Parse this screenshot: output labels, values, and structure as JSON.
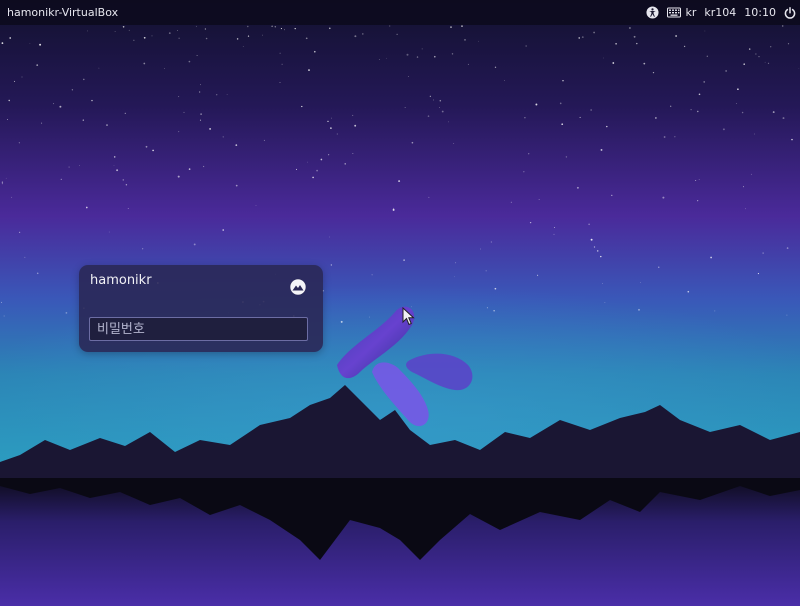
{
  "topbar": {
    "hostname": "hamonikr-VirtualBox",
    "indicators": {
      "accessibility_icon": "accessibility-icon",
      "keyboard_icon": "keyboard-icon",
      "keyboard_layout": "kr",
      "network_label": "kr104",
      "clock": "10:10",
      "power_icon": "power-icon"
    }
  },
  "login": {
    "username": "hamonikr",
    "session_icon": "session-selector-icon",
    "password_placeholder": "비밀번호",
    "password_value": ""
  },
  "colors": {
    "sky_top": "#12112e",
    "sky_mid": "#4a2a9a",
    "horizon": "#2b84b5",
    "mountains": "#1a1633",
    "reflection": "#3c2790",
    "panel_bg": "#2a2856",
    "input_border": "#6c6da4"
  }
}
